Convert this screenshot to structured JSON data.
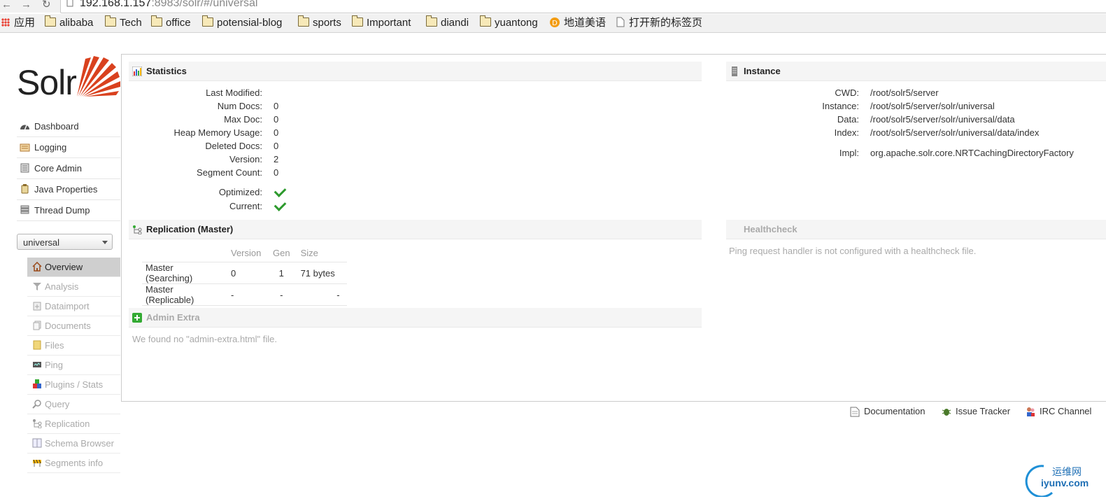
{
  "browser": {
    "url_host": "192.168.1.157",
    "url_rest": ":8983/solr/#/universal",
    "bookmarks": [
      {
        "label": "应用",
        "icon": "apps-icon"
      },
      {
        "label": "alibaba",
        "icon": "folder-icon"
      },
      {
        "label": "Tech",
        "icon": "folder-icon"
      },
      {
        "label": "office",
        "icon": "folder-icon"
      },
      {
        "label": "potensial-blog",
        "icon": "folder-icon"
      },
      {
        "label": "sports",
        "icon": "folder-icon"
      },
      {
        "label": "Important",
        "icon": "folder-icon"
      },
      {
        "label": "diandi",
        "icon": "folder-icon"
      },
      {
        "label": "yuantong",
        "icon": "folder-icon"
      },
      {
        "label": "地道美语",
        "icon": "site-icon"
      },
      {
        "label": "打开新的标签页",
        "icon": "page-icon"
      }
    ]
  },
  "logo": {
    "text": "Solr"
  },
  "main_nav": [
    {
      "label": "Dashboard",
      "icon": "dashboard-icon"
    },
    {
      "label": "Logging",
      "icon": "logging-icon"
    },
    {
      "label": "Core Admin",
      "icon": "core-admin-icon"
    },
    {
      "label": "Java Properties",
      "icon": "java-icon"
    },
    {
      "label": "Thread Dump",
      "icon": "thread-dump-icon"
    }
  ],
  "core_selector": {
    "value": "universal"
  },
  "core_nav": [
    {
      "label": "Overview",
      "icon": "home-icon",
      "active": true
    },
    {
      "label": "Analysis",
      "icon": "funnel-icon"
    },
    {
      "label": "Dataimport",
      "icon": "dataimport-icon"
    },
    {
      "label": "Documents",
      "icon": "documents-icon"
    },
    {
      "label": "Files",
      "icon": "files-icon"
    },
    {
      "label": "Ping",
      "icon": "ping-icon"
    },
    {
      "label": "Plugins / Stats",
      "icon": "plugins-icon"
    },
    {
      "label": "Query",
      "icon": "query-icon"
    },
    {
      "label": "Replication",
      "icon": "replication-icon"
    },
    {
      "label": "Schema Browser",
      "icon": "schema-icon"
    },
    {
      "label": "Segments info",
      "icon": "segments-icon"
    }
  ],
  "statistics": {
    "title": "Statistics",
    "rows": [
      {
        "key": "Last Modified:",
        "value": ""
      },
      {
        "key": "Num Docs:",
        "value": "0"
      },
      {
        "key": "Max Doc:",
        "value": "0"
      },
      {
        "key": "Heap Memory Usage:",
        "value": "0"
      },
      {
        "key": "Deleted Docs:",
        "value": "0"
      },
      {
        "key": "Version:",
        "value": "2"
      },
      {
        "key": "Segment Count:",
        "value": "0"
      }
    ],
    "flags": [
      {
        "key": "Optimized:",
        "value": true
      },
      {
        "key": "Current:",
        "value": true
      }
    ]
  },
  "instance": {
    "title": "Instance",
    "rows": [
      {
        "key": "CWD:",
        "value": "/root/solr5/server"
      },
      {
        "key": "Instance:",
        "value": "/root/solr5/server/solr/universal"
      },
      {
        "key": "Data:",
        "value": "/root/solr5/server/solr/universal/data"
      },
      {
        "key": "Index:",
        "value": "/root/solr5/server/solr/universal/data/index"
      },
      {
        "key": "Impl:",
        "value": "org.apache.solr.core.NRTCachingDirectoryFactory"
      }
    ]
  },
  "replication": {
    "title": "Replication (Master)",
    "columns": [
      "",
      "Version",
      "Gen",
      "Size"
    ],
    "rows": [
      [
        "Master (Searching)",
        "0",
        "1",
        "71 bytes"
      ],
      [
        "Master (Replicable)",
        "-",
        "-",
        "-"
      ]
    ]
  },
  "healthcheck": {
    "title": "Healthcheck",
    "message": "Ping request handler is not configured with a healthcheck file."
  },
  "admin_extra": {
    "title": "Admin Extra",
    "message": "We found no \"admin-extra.html\" file."
  },
  "footer": [
    {
      "label": "Documentation",
      "icon": "documentation-icon"
    },
    {
      "label": "Issue Tracker",
      "icon": "bug-icon"
    },
    {
      "label": "IRC Channel",
      "icon": "irc-icon"
    }
  ],
  "watermark": {
    "cn": "运维网",
    "en": "iyunv.com"
  },
  "colors": {
    "accent": "#d9411e",
    "check": "#2d9a2d",
    "active_nav": "#cfcfcf"
  }
}
